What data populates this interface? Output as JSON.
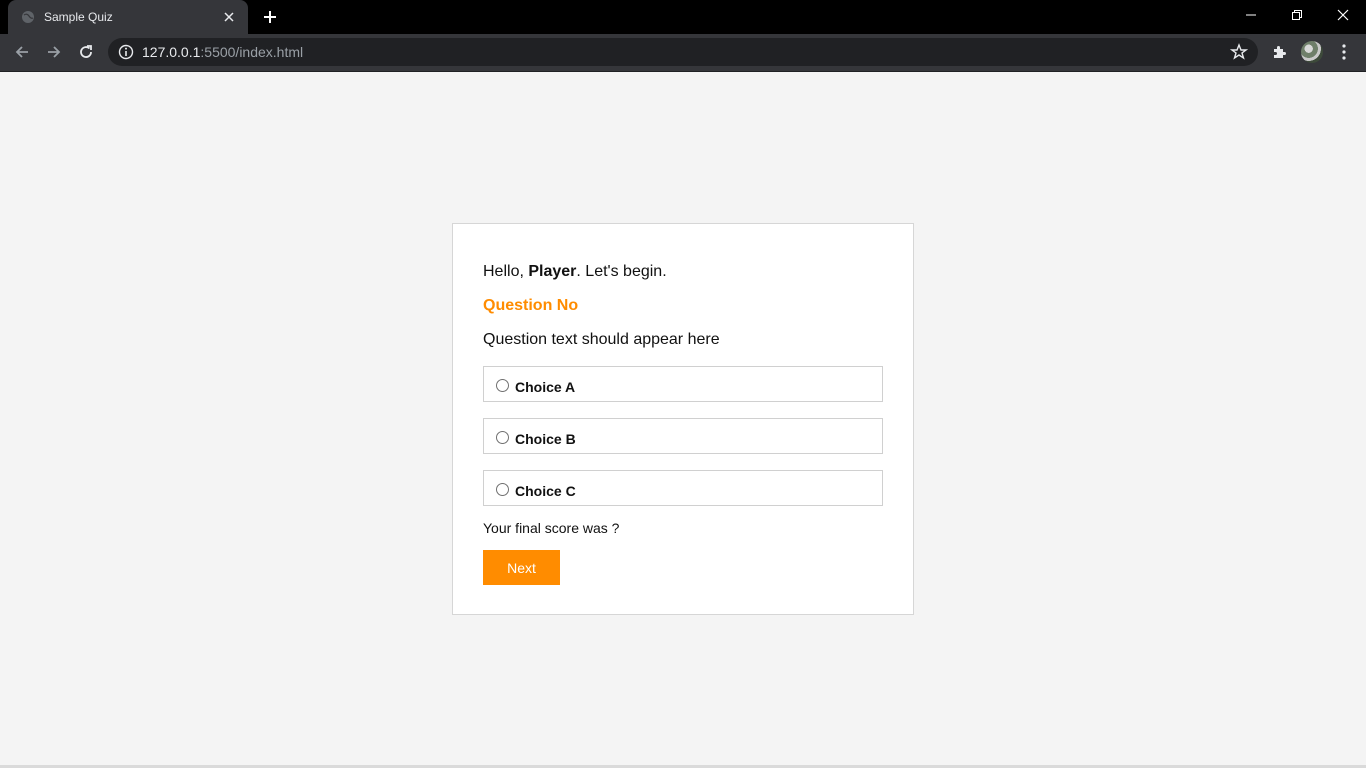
{
  "browser": {
    "tab_title": "Sample Quiz",
    "url_host": "127.0.0.1",
    "url_rest": ":5500/index.html",
    "colors": {
      "titlebar": "#000000",
      "toolbar": "#35363a",
      "omnibox": "#202124"
    }
  },
  "quiz": {
    "greeting_prefix": "Hello, ",
    "player_name": "Player",
    "greeting_suffix": ". Let's begin.",
    "question_no": "Question No",
    "question_text": "Question text should appear here",
    "choices": [
      {
        "label": "Choice A"
      },
      {
        "label": "Choice B"
      },
      {
        "label": "Choice C"
      }
    ],
    "score_text": "Your final score was ?",
    "next_label": "Next",
    "accent_color": "#ff8c00"
  }
}
